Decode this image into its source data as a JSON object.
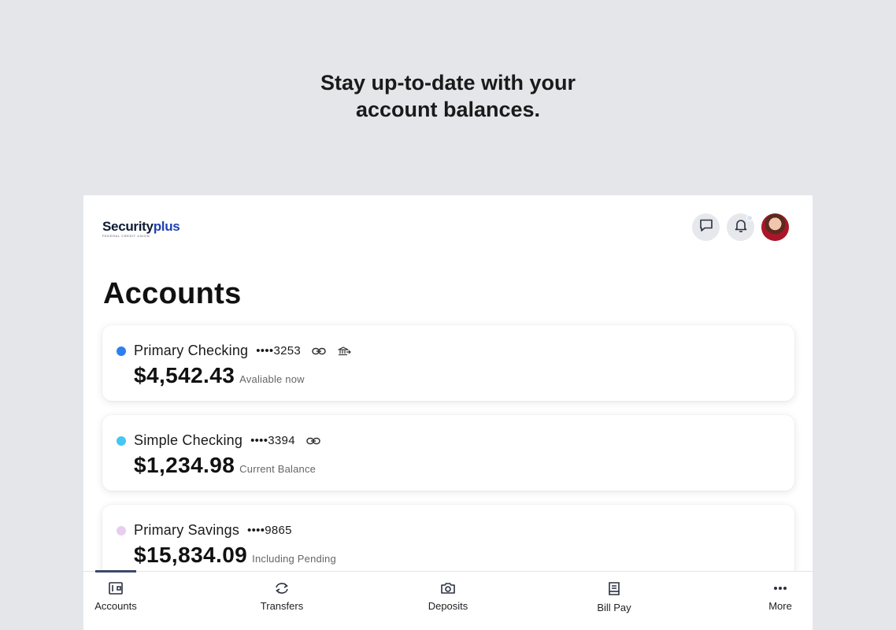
{
  "headline": {
    "line1": "Stay up-to-date with your",
    "line2": "account balances."
  },
  "brand": {
    "name_part1": "Security",
    "name_part2": "plus",
    "tagline": "FEDERAL CREDIT UNION"
  },
  "header": {
    "chat_icon": "chat-icon",
    "bell_icon": "bell-icon",
    "avatar": "user-avatar"
  },
  "page": {
    "title": "Accounts"
  },
  "accounts": [
    {
      "name": "Primary Checking",
      "number": "••••3253",
      "balance": "$4,542.43",
      "label": "Avaliable now",
      "color": "#2d7ff0",
      "icons": [
        "link-icon",
        "bank-transfer-icon"
      ]
    },
    {
      "name": "Simple Checking",
      "number": "••••3394",
      "balance": "$1,234.98",
      "label": "Current Balance",
      "color": "#45c6f3",
      "icons": [
        "link-icon"
      ]
    },
    {
      "name": "Primary Savings",
      "number": "••••9865",
      "balance": "$15,834.09",
      "label": "Including Pending",
      "color": "#e9cdee",
      "icons": []
    }
  ],
  "nav": {
    "accounts": "Accounts",
    "transfers": "Transfers",
    "deposits": "Deposits",
    "billpay": "Bill Pay",
    "more": "More"
  }
}
